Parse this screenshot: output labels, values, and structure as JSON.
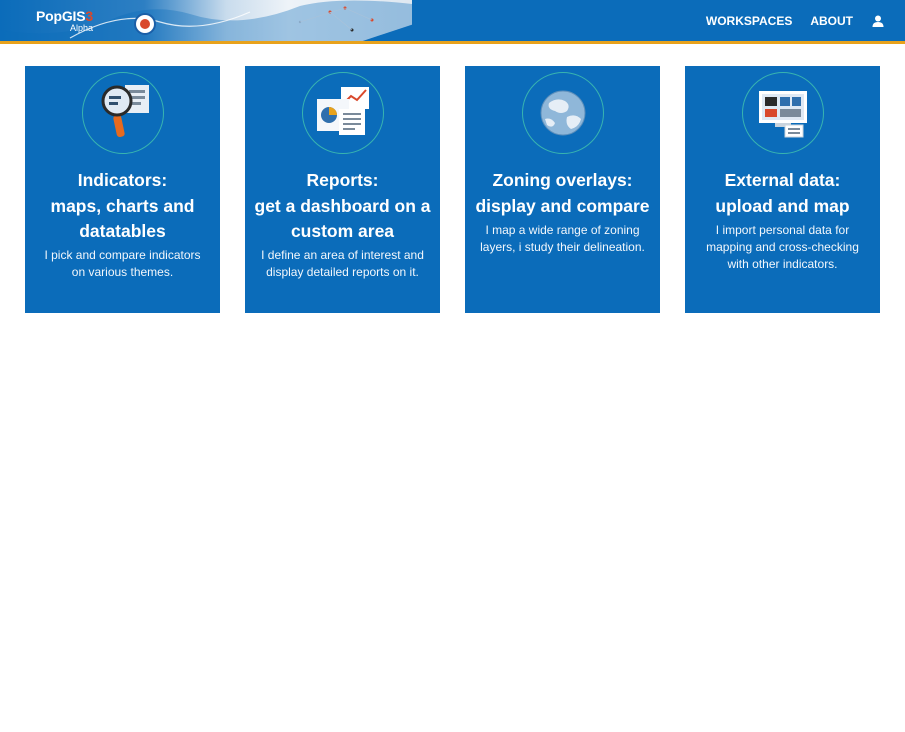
{
  "header": {
    "logo_text": "PopGIS",
    "logo_suffix": "3",
    "logo_sub": "Alpha",
    "nav": [
      {
        "label": "WORKSPACES"
      },
      {
        "label": "ABOUT"
      }
    ],
    "user_icon": "user-icon"
  },
  "colors": {
    "primary": "#0b6cba",
    "accent_border": "#e8a21c",
    "icon_ring": "#38b4b0"
  },
  "cards": [
    {
      "icon": "magnifier-icon",
      "title": "Indicators:\nmaps, charts and\ndatatables",
      "description": "I pick and compare indicators\non various themes."
    },
    {
      "icon": "report-icon",
      "title": "Reports:\nget a dashboard on a\ncustom area",
      "description": "I define an area of interest and\ndisplay detailed reports on it."
    },
    {
      "icon": "globe-icon",
      "title": "Zoning overlays:\ndisplay and compare",
      "description": "I map a wide range of zoning\nlayers, i study their delineation."
    },
    {
      "icon": "monitor-icon",
      "title": "External data:\nupload and map",
      "description": "I import personal data for\nmapping and cross-checking\nwith other indicators."
    }
  ]
}
